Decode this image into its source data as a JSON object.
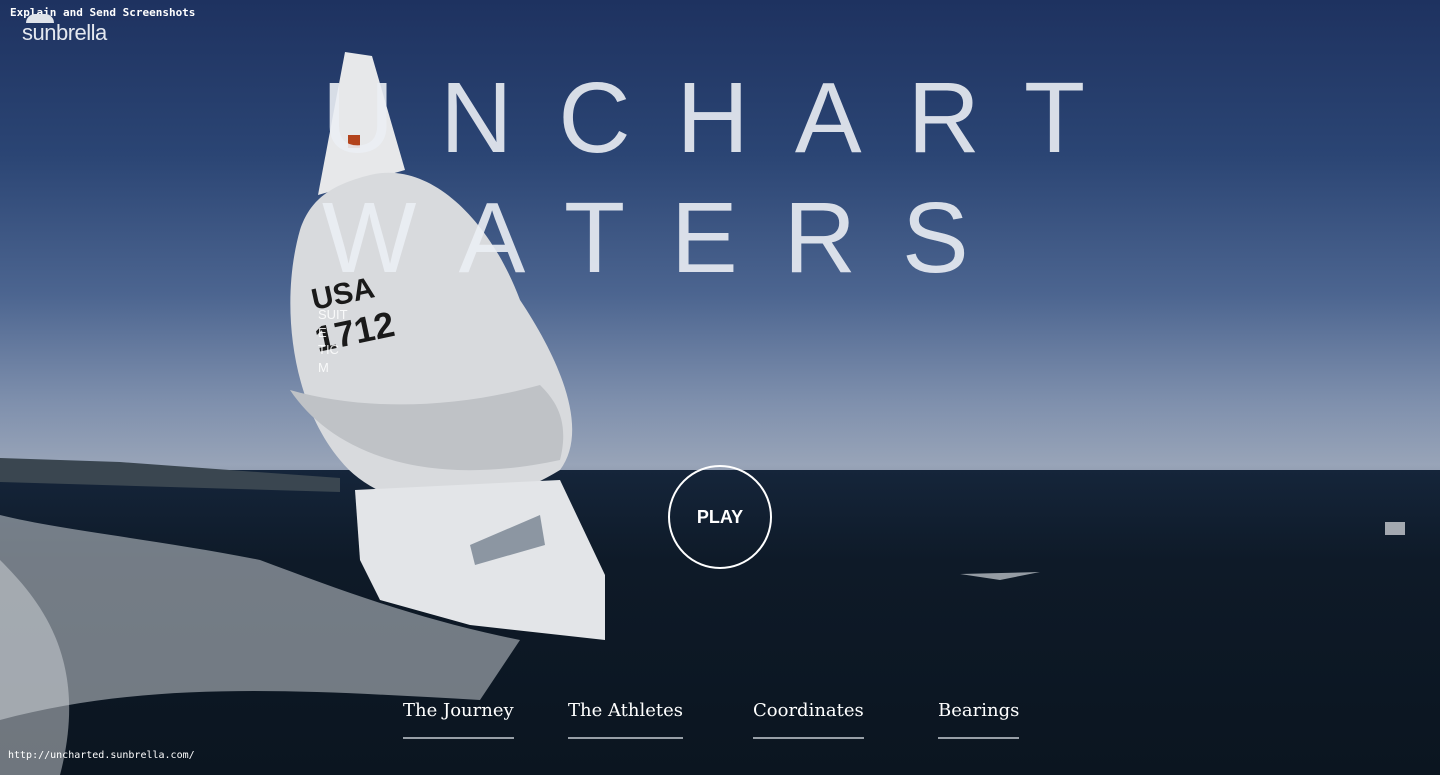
{
  "window": {
    "title": "Explain and Send Screenshots"
  },
  "brand": {
    "logo_text": "sunbrella"
  },
  "hero": {
    "title_line1": "UNCHART",
    "title_line2": "WATERS",
    "overlay_fragments": [
      "SUIT",
      "E",
      "TIC",
      "M"
    ]
  },
  "play": {
    "label": "PLAY"
  },
  "nav": {
    "items": [
      {
        "label": "The Journey"
      },
      {
        "label": "The Athletes"
      },
      {
        "label": "Coordinates"
      },
      {
        "label": "Bearings"
      }
    ]
  },
  "status": {
    "url": "http://uncharted.sunbrella.com/"
  }
}
